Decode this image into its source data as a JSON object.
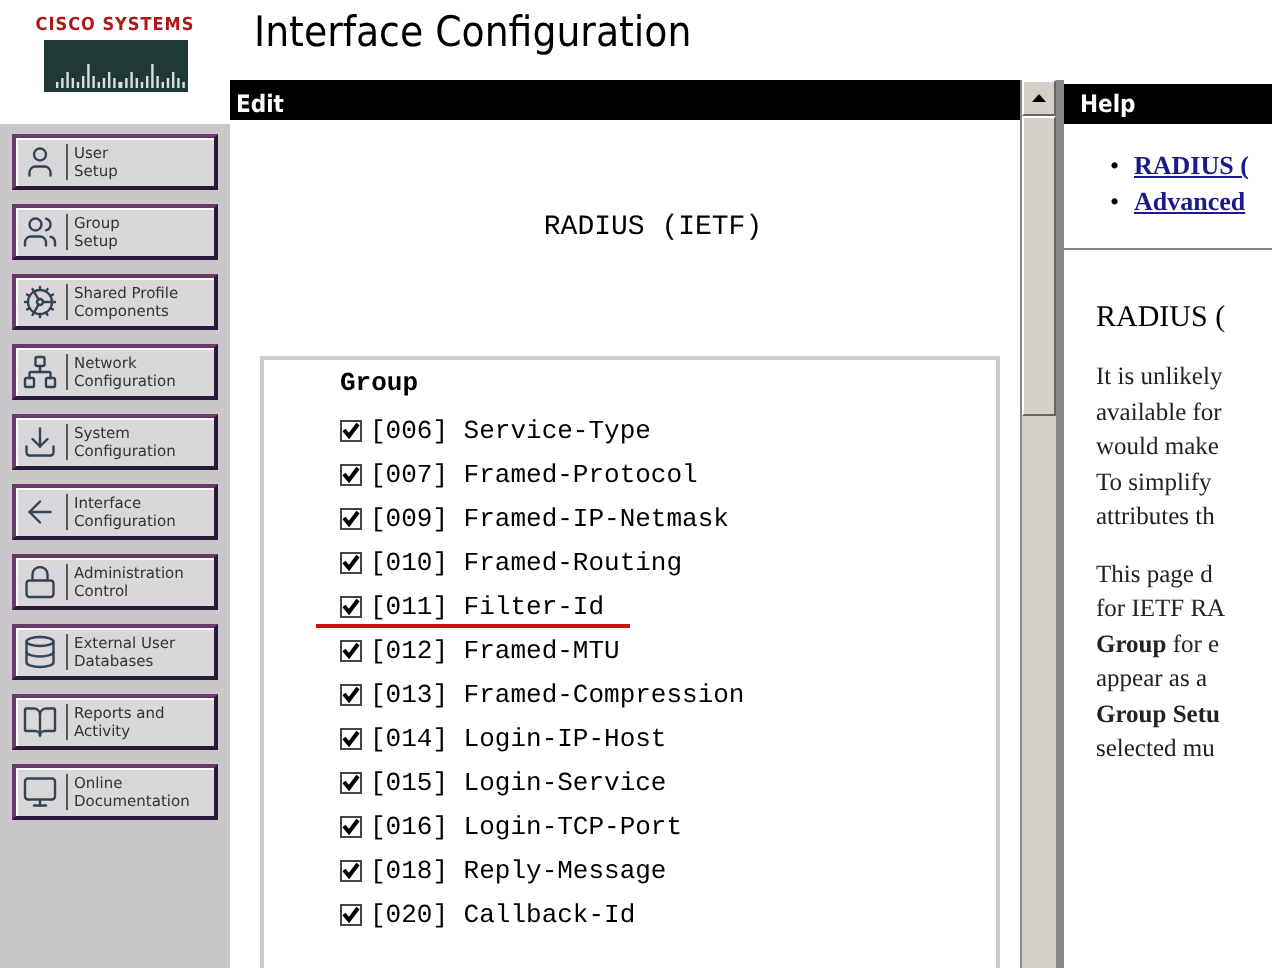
{
  "logo": {
    "text": "CISCO SYSTEMS"
  },
  "title": "Interface Configuration",
  "nav": [
    {
      "label": "User\nSetup"
    },
    {
      "label": "Group\nSetup"
    },
    {
      "label": "Shared Profile\nComponents"
    },
    {
      "label": "Network\nConfiguration"
    },
    {
      "label": "System\nConfiguration"
    },
    {
      "label": "Interface\nConfiguration"
    },
    {
      "label": "Administration\nControl"
    },
    {
      "label": "External User\nDatabases"
    },
    {
      "label": "Reports and\nActivity"
    },
    {
      "label": "Online\nDocumentation"
    }
  ],
  "edit": {
    "header": "Edit",
    "heading": "RADIUS (IETF)",
    "group_label": "Group",
    "attributes": [
      {
        "label": "[006] Service-Type",
        "checked": true,
        "underlined": false
      },
      {
        "label": "[007] Framed-Protocol",
        "checked": true,
        "underlined": false
      },
      {
        "label": "[009] Framed-IP-Netmask",
        "checked": true,
        "underlined": false
      },
      {
        "label": "[010] Framed-Routing",
        "checked": true,
        "underlined": false
      },
      {
        "label": "[011] Filter-Id",
        "checked": true,
        "underlined": true
      },
      {
        "label": "[012] Framed-MTU",
        "checked": true,
        "underlined": false
      },
      {
        "label": "[013] Framed-Compression",
        "checked": true,
        "underlined": false
      },
      {
        "label": "[014] Login-IP-Host",
        "checked": true,
        "underlined": false
      },
      {
        "label": "[015] Login-Service",
        "checked": true,
        "underlined": false
      },
      {
        "label": "[016] Login-TCP-Port",
        "checked": true,
        "underlined": false
      },
      {
        "label": "[018] Reply-Message",
        "checked": true,
        "underlined": false
      },
      {
        "label": "[020] Callback-Id",
        "checked": true,
        "underlined": false
      }
    ]
  },
  "help": {
    "header": "Help",
    "links": [
      {
        "bullet": "•",
        "label": "RADIUS ("
      },
      {
        "bullet": "•",
        "label": "Advanced"
      }
    ],
    "heading": "RADIUS (",
    "paragraphs": [
      [
        "It is unlikely",
        "available for",
        "would make",
        "To simplify",
        "attributes th"
      ],
      [
        "This page d",
        "for IETF RA",
        "**Group** for e",
        "appear as a",
        "**Group Setu**",
        "selected mu"
      ]
    ]
  }
}
